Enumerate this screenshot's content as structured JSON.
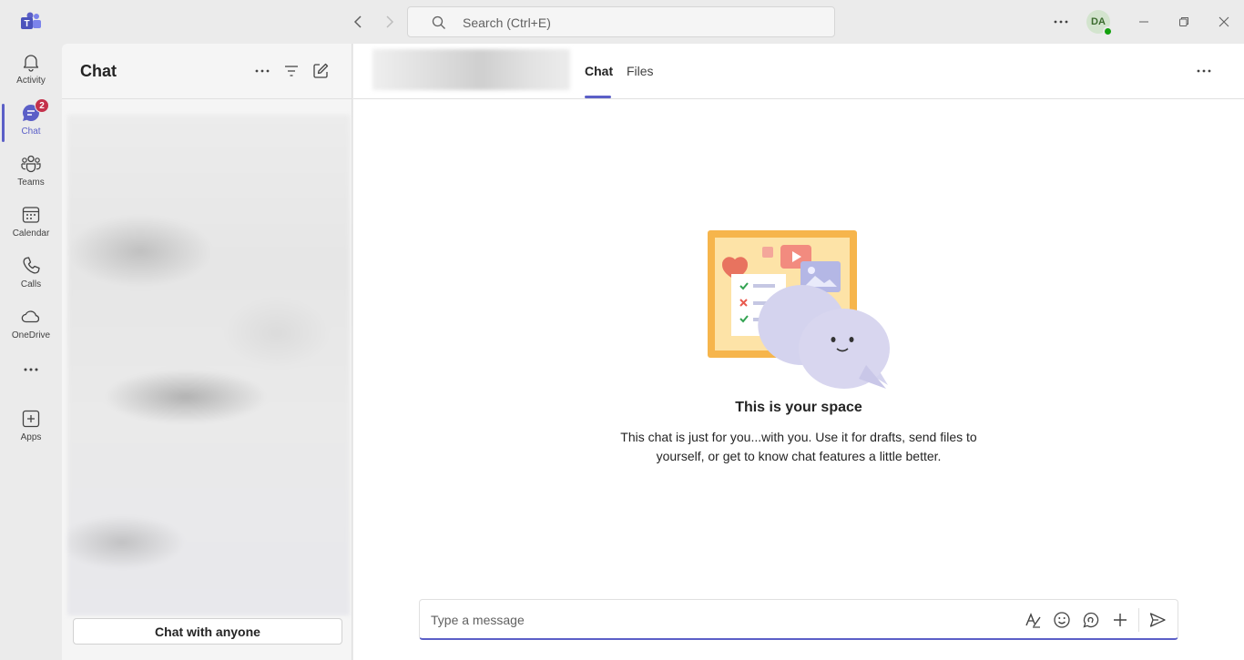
{
  "titlebar": {
    "app_icon": "teams-logo-icon",
    "search_placeholder": "Search (Ctrl+E)",
    "more_icon": "more-horizontal-icon",
    "avatar_initials": "DA",
    "presence": "available"
  },
  "rail": {
    "items": [
      {
        "label": "Activity",
        "icon": "bell-icon"
      },
      {
        "label": "Chat",
        "icon": "chat-icon",
        "badge": "2"
      },
      {
        "label": "Teams",
        "icon": "teams-icon"
      },
      {
        "label": "Calendar",
        "icon": "calendar-icon"
      },
      {
        "label": "Calls",
        "icon": "phone-icon"
      },
      {
        "label": "OneDrive",
        "icon": "cloud-icon"
      },
      {
        "label": "",
        "icon": "more-horizontal-icon"
      },
      {
        "label": "Apps",
        "icon": "add-app-icon"
      }
    ]
  },
  "chatlist": {
    "title": "Chat",
    "chat_anyone_label": "Chat with anyone"
  },
  "main": {
    "tabs": [
      {
        "label": "Chat",
        "active": true
      },
      {
        "label": "Files",
        "active": false
      }
    ],
    "empty_title": "This is your space",
    "empty_desc": "This chat is just for you...with you. Use it for drafts, send files to yourself, or get to know chat features a little better.",
    "composer_placeholder": "Type a message"
  },
  "colors": {
    "accent": "#5b5fc7",
    "badge": "#c4314b",
    "presence_available": "#13a10e"
  }
}
